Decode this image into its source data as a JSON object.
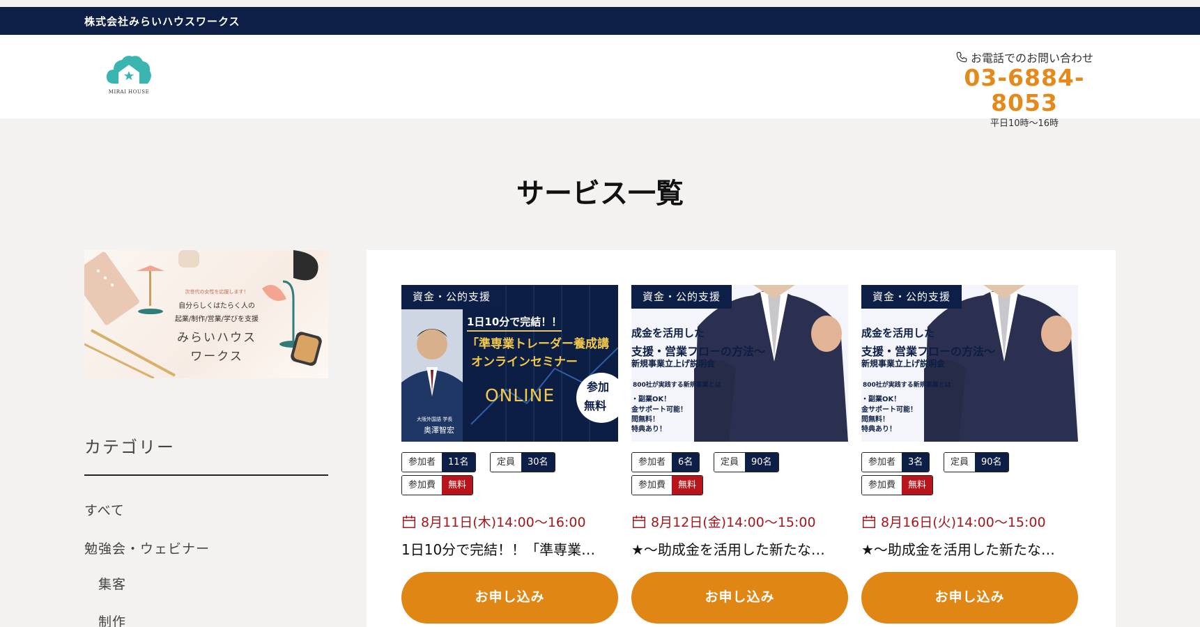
{
  "topbar": {
    "company": "株式会社みらいハウスワークス"
  },
  "header": {
    "logo_text": "MIRAI HOUSE",
    "contact_label": "お電話でのお問い合わせ",
    "phone": "03-6884-8053",
    "hours": "平日10時～16時"
  },
  "page_title": "サービス一覧",
  "banner": {
    "line1": "次世代の女性を応援します！",
    "line2": "自分らしくはたらく人の",
    "line3": "起業/制作/営業/学びを支援",
    "line4": "みらいハウス",
    "line5": "ワークス"
  },
  "sidebar": {
    "heading": "カテゴリー",
    "links": [
      {
        "label": "すべて"
      },
      {
        "label": "勉強会・ウェビナー"
      },
      {
        "label": "集客"
      },
      {
        "label": "制作"
      }
    ]
  },
  "cards": [
    {
      "category": "資金・公的支援",
      "thumb": {
        "line1": "1日10分で完結！！",
        "line2": "「準専業トレーダー養成講",
        "line3": "オンラインセミナー",
        "online": "ONLINE",
        "badge1": "参加",
        "badge2": "無料",
        "person_title": "大阪外国語 学長",
        "person_name": "奥澤智宏"
      },
      "participants_label": "参加者",
      "participants": "11名",
      "capacity_label": "定員",
      "capacity": "30名",
      "fee_label": "参加費",
      "fee": "無料",
      "date": "8月11日(木)14:00～16:00",
      "title": "1日10分で完結！！「準専業…",
      "apply": "お申し込み"
    },
    {
      "category": "資金・公的支援",
      "thumb": {
        "line1": "成金を活用した",
        "line2": "支援・営業フローの方法～",
        "line3": "新規事業立上げ説明会",
        "b1": "800社が実践する新規事業とは",
        "b2": "・副業OK！",
        "b3": "金サポート可能！",
        "b4": "問無料！",
        "b5": "特典あり！"
      },
      "participants_label": "参加者",
      "participants": "6名",
      "capacity_label": "定員",
      "capacity": "90名",
      "fee_label": "参加費",
      "fee": "無料",
      "date": "8月12日(金)14:00～15:00",
      "title": "★～助成金を活用した新たな…",
      "apply": "お申し込み"
    },
    {
      "category": "資金・公的支援",
      "thumb": {
        "line1": "成金を活用した",
        "line2": "支援・営業フローの方法～",
        "line3": "新規事業立上げ説明会",
        "b1": "800社が実践する新規事業とは",
        "b2": "・副業OK！",
        "b3": "金サポート可能！",
        "b4": "問無料！",
        "b5": "特典あり！"
      },
      "participants_label": "参加者",
      "participants": "3名",
      "capacity_label": "定員",
      "capacity": "90名",
      "fee_label": "参加費",
      "fee": "無料",
      "date": "8月16日(火)14:00～15:00",
      "title": "★～助成金を活用した新たな…",
      "apply": "お申し込み"
    }
  ],
  "colors": {
    "navy": "#0e1f47",
    "orange": "#e08614",
    "red": "#b8141b",
    "date_red": "#a3171c"
  }
}
